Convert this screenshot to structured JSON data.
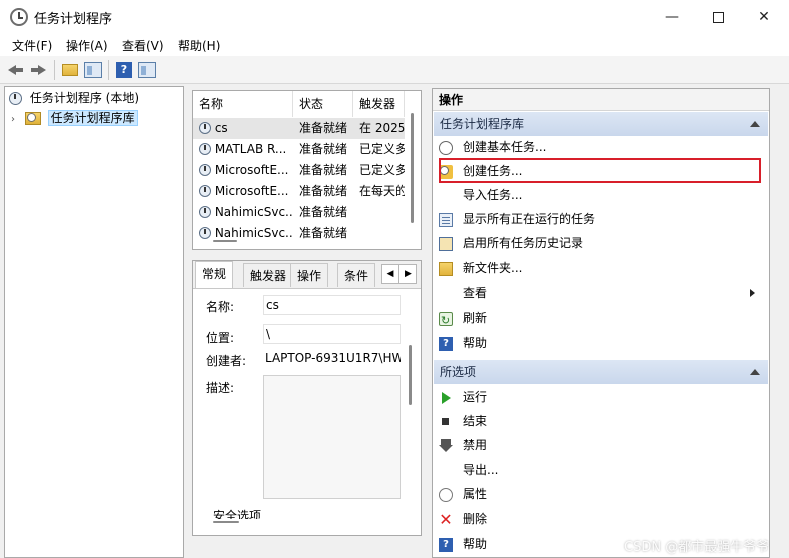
{
  "window": {
    "title": "任务计划程序",
    "controls": {
      "minimize": "—",
      "close": "✕"
    }
  },
  "menu": [
    "文件(F)",
    "操作(A)",
    "查看(V)",
    "帮助(H)"
  ],
  "toolbar": {
    "help_glyph": "?"
  },
  "tree": {
    "root": "任务计划程序 (本地)",
    "child": "任务计划程序库"
  },
  "task_list": {
    "columns": [
      "名称",
      "状态",
      "触发器"
    ],
    "rows": [
      [
        "cs",
        "准备就绪",
        "在 2025"
      ],
      [
        "MATLAB R...",
        "准备就绪",
        "已定义多"
      ],
      [
        "MicrosoftE...",
        "准备就绪",
        "已定义多"
      ],
      [
        "MicrosoftE...",
        "准备就绪",
        "在每天的"
      ],
      [
        "NahimicSvc...",
        "准备就绪",
        ""
      ],
      [
        "NahimicSvc...",
        "准备就绪",
        ""
      ]
    ]
  },
  "details": {
    "tabs": [
      "常规",
      "触发器",
      "操作",
      "条件"
    ],
    "tab_prev": "◀",
    "tab_next": "▶",
    "fields": {
      "name_label": "名称:",
      "name_value": "cs",
      "location_label": "位置:",
      "location_value": "\\",
      "author_label": "创建者:",
      "author_value": "LAPTOP-6931U1R7\\HW",
      "description_label": "描述:",
      "security_label": "安全选项"
    }
  },
  "actions": {
    "header": "操作",
    "library_section": "任务计划程序库",
    "library_items": [
      {
        "label": "创建基本任务...",
        "icon": "basic-task-icon"
      },
      {
        "label": "创建任务...",
        "icon": "create-task-icon",
        "highlighted": true
      },
      {
        "label": "导入任务...",
        "icon": ""
      },
      {
        "label": "显示所有正在运行的任务",
        "icon": "running-tasks-icon"
      },
      {
        "label": "启用所有任务历史记录",
        "icon": "history-icon"
      },
      {
        "label": "新文件夹...",
        "icon": "folder-icon"
      },
      {
        "label": "查看",
        "icon": "",
        "submenu": true
      },
      {
        "label": "刷新",
        "icon": "refresh-icon"
      },
      {
        "label": "帮助",
        "icon": "help-icon"
      }
    ],
    "selected_section": "所选项",
    "selected_items": [
      {
        "label": "运行",
        "icon": "run-icon"
      },
      {
        "label": "结束",
        "icon": "end-icon"
      },
      {
        "label": "禁用",
        "icon": "disable-icon"
      },
      {
        "label": "导出...",
        "icon": ""
      },
      {
        "label": "属性",
        "icon": "properties-icon"
      },
      {
        "label": "删除",
        "icon": "delete-icon"
      },
      {
        "label": "帮助",
        "icon": "help-icon"
      }
    ],
    "highlight_color": "#d81f2a"
  },
  "watermark": "CSDN @都市最强牛爷爷"
}
